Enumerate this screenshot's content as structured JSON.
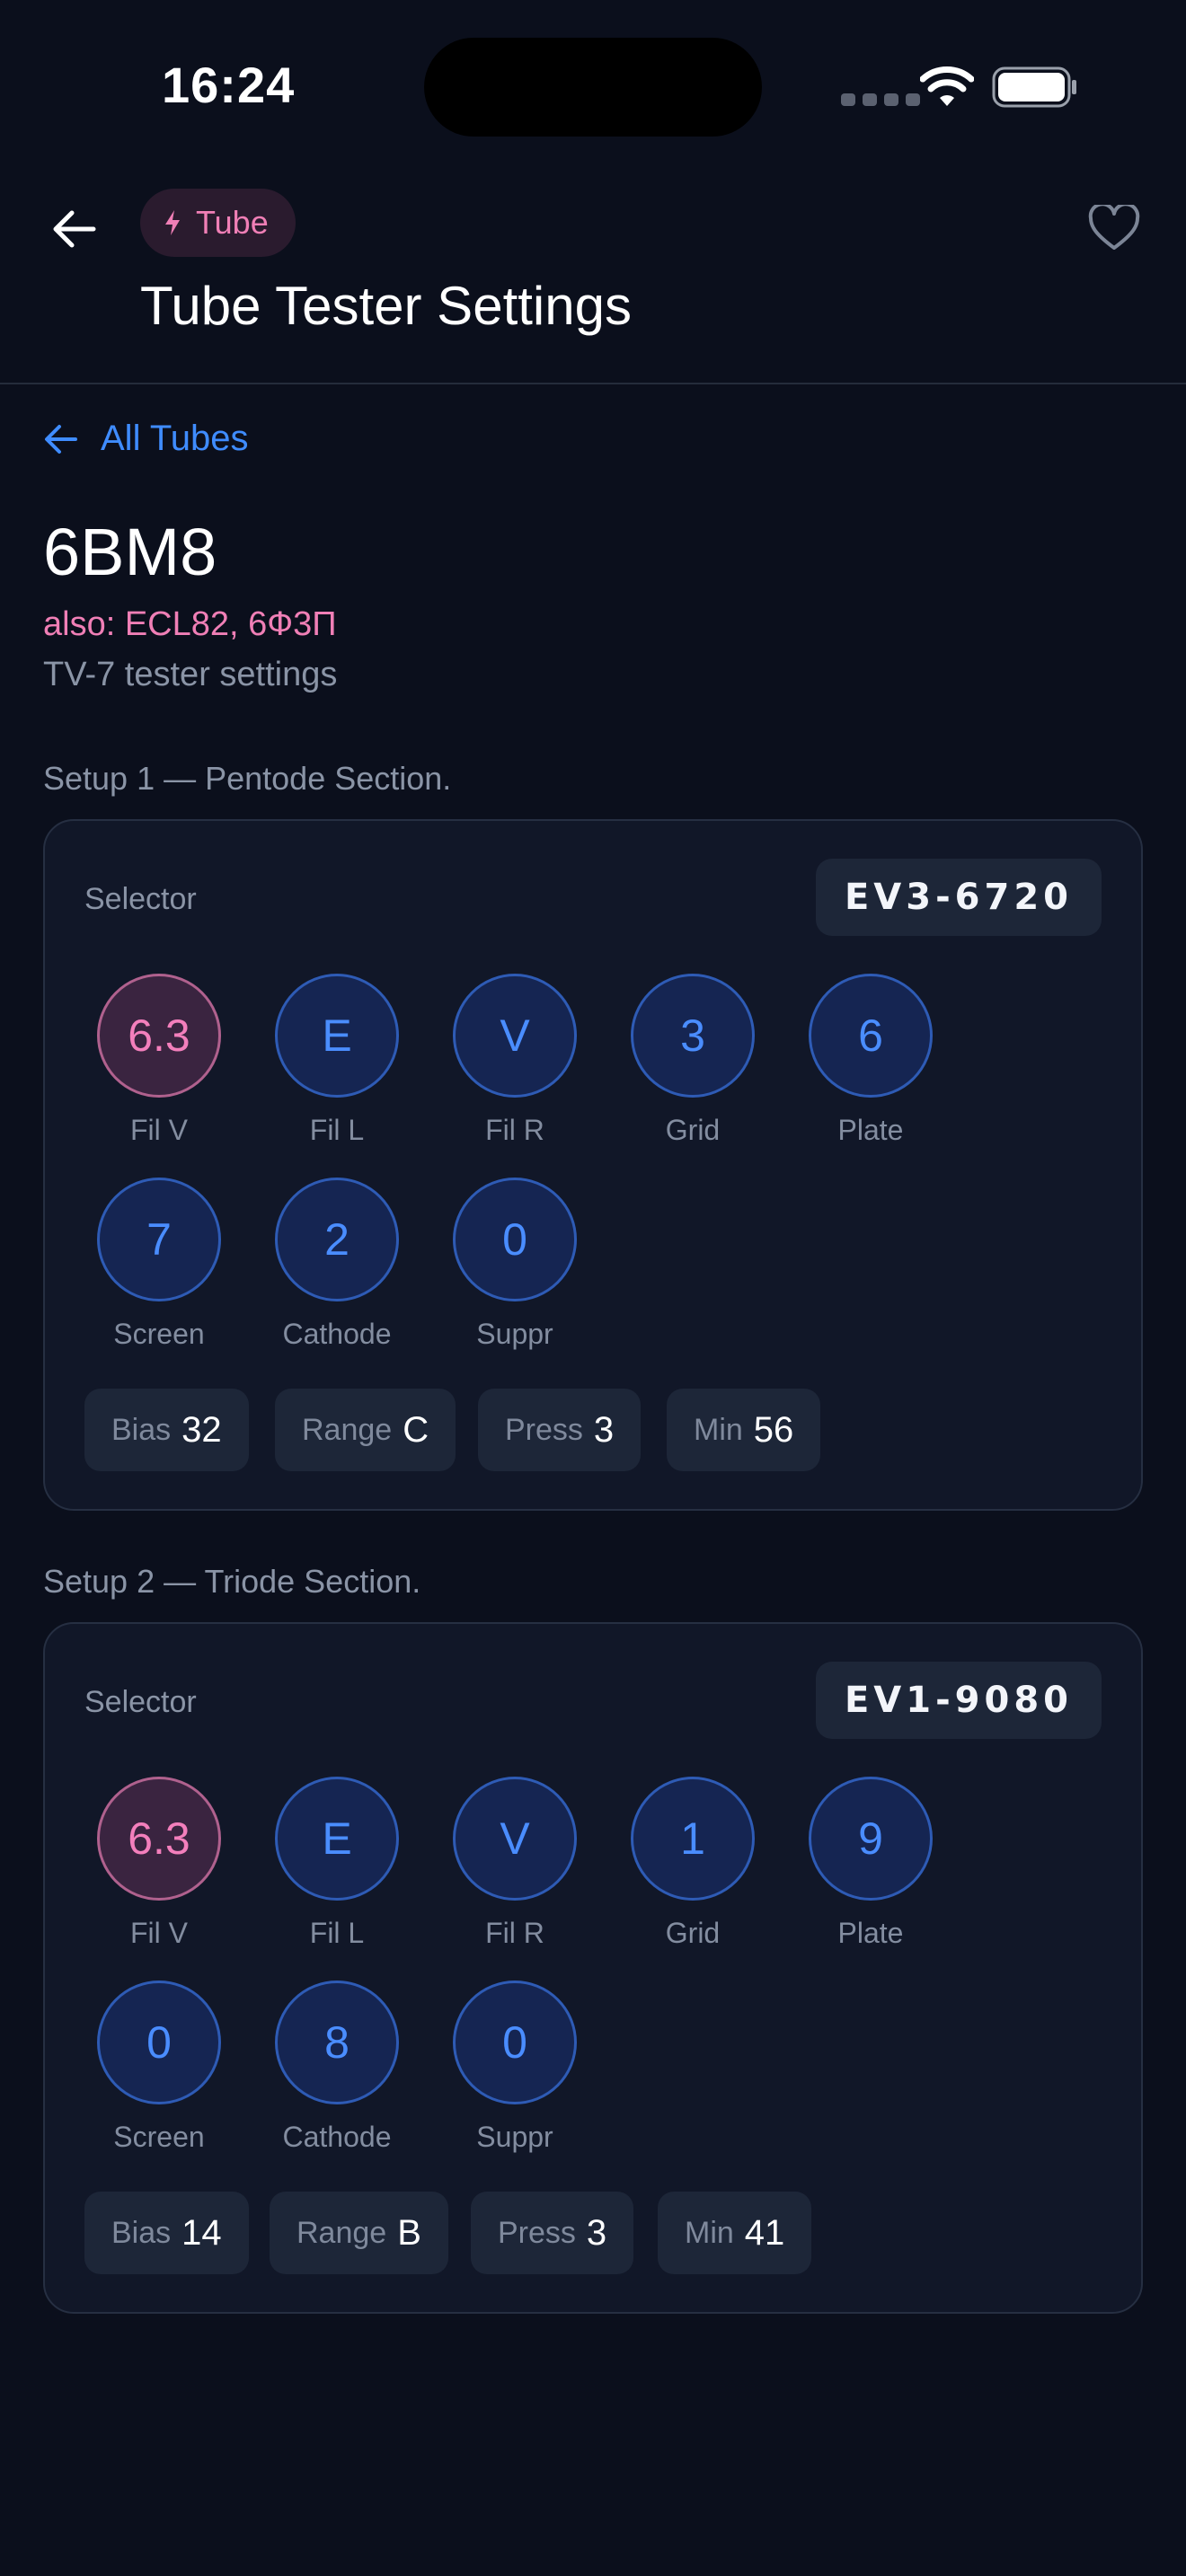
{
  "status_bar": {
    "time": "16:24"
  },
  "header": {
    "chip_label": "Tube",
    "title": "Tube Tester Settings"
  },
  "nav": {
    "all_tubes_label": "All Tubes"
  },
  "tube": {
    "name": "6BM8",
    "aliases": "also: ECL82, 6Ф3П",
    "subtitle": "TV-7 tester settings"
  },
  "colors": {
    "accent_blue": "#3f8cff",
    "accent_pink": "#f07fb6",
    "background": "#0b0f1c"
  },
  "setups": [
    {
      "label": "Setup 1 — Pentode Section.",
      "selector_label": "Selector",
      "selector_code": "EV3-6720",
      "dials": [
        {
          "value": "6.3",
          "caption": "Fil V"
        },
        {
          "value": "E",
          "caption": "Fil L"
        },
        {
          "value": "V",
          "caption": "Fil R"
        },
        {
          "value": "3",
          "caption": "Grid"
        },
        {
          "value": "6",
          "caption": "Plate"
        },
        {
          "value": "7",
          "caption": "Screen"
        },
        {
          "value": "2",
          "caption": "Cathode"
        },
        {
          "value": "0",
          "caption": "Suppr"
        }
      ],
      "params": [
        {
          "key": "Bias",
          "value": "32"
        },
        {
          "key": "Range",
          "value": "C"
        },
        {
          "key": "Press",
          "value": "3"
        },
        {
          "key": "Min",
          "value": "56"
        }
      ]
    },
    {
      "label": "Setup 2 — Triode Section.",
      "selector_label": "Selector",
      "selector_code": "EV1-9080",
      "dials": [
        {
          "value": "6.3",
          "caption": "Fil V"
        },
        {
          "value": "E",
          "caption": "Fil L"
        },
        {
          "value": "V",
          "caption": "Fil R"
        },
        {
          "value": "1",
          "caption": "Grid"
        },
        {
          "value": "9",
          "caption": "Plate"
        },
        {
          "value": "0",
          "caption": "Screen"
        },
        {
          "value": "8",
          "caption": "Cathode"
        },
        {
          "value": "0",
          "caption": "Suppr"
        }
      ],
      "params": [
        {
          "key": "Bias",
          "value": "14"
        },
        {
          "key": "Range",
          "value": "B"
        },
        {
          "key": "Press",
          "value": "3"
        },
        {
          "key": "Min",
          "value": "41"
        }
      ]
    }
  ]
}
